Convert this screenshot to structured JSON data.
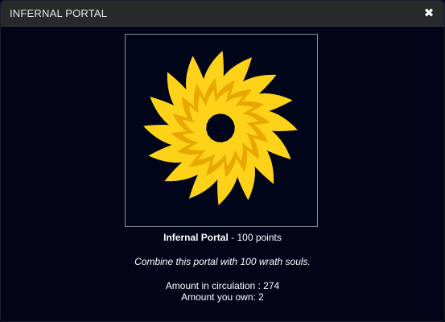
{
  "window": {
    "title": "INFERNAL PORTAL",
    "close_icon": "close-icon"
  },
  "item": {
    "name": "Infernal Portal",
    "points_text": " - 100 points",
    "description": "Combine this portal with 100 wrath souls.",
    "circulation_text": "Amount in circulation : 274",
    "owned_text": "Amount you own: 2",
    "image_icon": "yellow-spiral-portal",
    "colors": {
      "petal_light": "#ffd21a",
      "petal_dark": "#e8a800",
      "background": "#01051a"
    }
  }
}
